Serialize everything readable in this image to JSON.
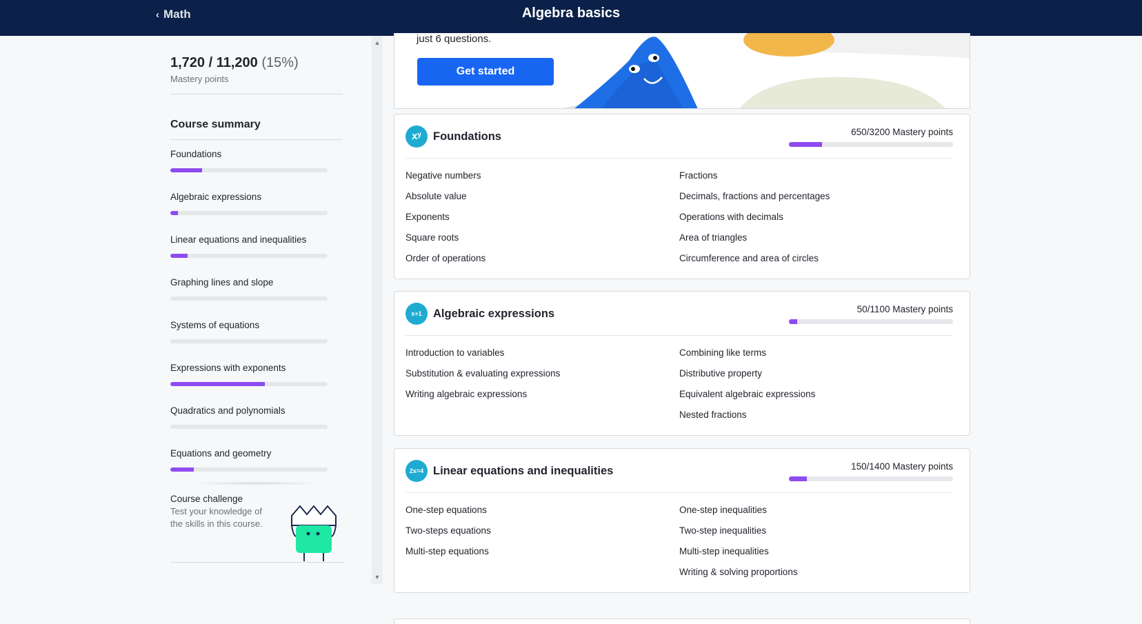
{
  "header": {
    "back_label": "Math",
    "title": "Algebra basics"
  },
  "mastery": {
    "current": "1,720",
    "total": "11,200",
    "percent": "(15%)",
    "label": "Mastery points"
  },
  "summary": {
    "heading": "Course summary",
    "items": [
      {
        "label": "Foundations",
        "progress": 0.2
      },
      {
        "label": "Algebraic expressions",
        "progress": 0.05
      },
      {
        "label": "Linear equations and inequalities",
        "progress": 0.11
      },
      {
        "label": "Graphing lines and slope",
        "progress": 0
      },
      {
        "label": "Systems of equations",
        "progress": 0
      },
      {
        "label": "Expressions with exponents",
        "progress": 0.6
      },
      {
        "label": "Quadratics and polynomials",
        "progress": 0
      },
      {
        "label": "Equations and geometry",
        "progress": 0.15
      }
    ],
    "challenge": {
      "title": "Course challenge",
      "desc": "Test your knowledge of the skills in this course."
    }
  },
  "hero": {
    "text": "just 6 questions.",
    "button": "Get started"
  },
  "units": [
    {
      "title": "Foundations",
      "icon": "xʸ",
      "points": "650/3200 Mastery points",
      "progress": 0.2,
      "left": [
        "Negative numbers",
        "Absolute value",
        "Exponents",
        "Square roots",
        "Order of operations"
      ],
      "right": [
        "Fractions",
        "Decimals, fractions and percentages",
        "Operations with decimals",
        "Area of triangles",
        "Circumference and area of circles"
      ]
    },
    {
      "title": "Algebraic expressions",
      "icon": "x+1",
      "points": "50/1100 Mastery points",
      "progress": 0.05,
      "left": [
        "Introduction to variables",
        "Substitution & evaluating expressions",
        "Writing algebraic expressions"
      ],
      "right": [
        "Combining like terms",
        "Distributive property",
        "Equivalent algebraic expressions",
        "Nested fractions"
      ]
    },
    {
      "title": "Linear equations and inequalities",
      "icon": "2x=4",
      "points": "150/1400 Mastery points",
      "progress": 0.11,
      "left": [
        "One-step equations",
        "Two-steps equations",
        "Multi-step equations"
      ],
      "right": [
        "One-step inequalities",
        "Two-step inequalities",
        "Multi-step inequalities",
        "Writing & solving proportions"
      ]
    }
  ],
  "colors": {
    "header_bg": "#0b2149",
    "progress": "#8e4bf0",
    "button": "#1865f2",
    "unit_icon": "#1fabd1"
  }
}
